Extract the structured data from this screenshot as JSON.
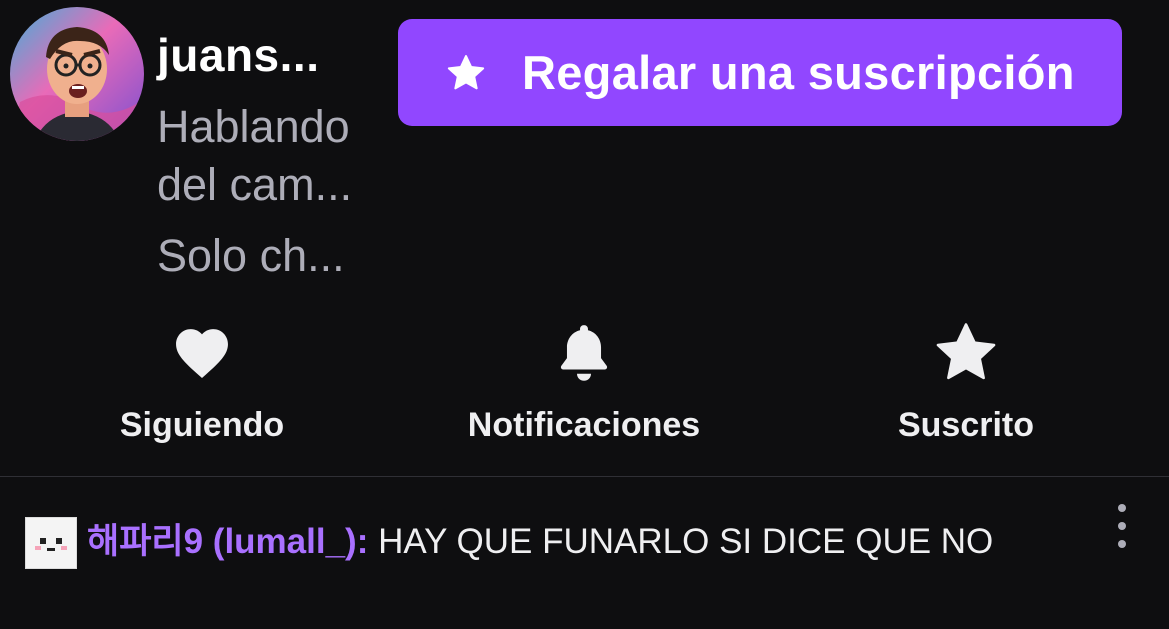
{
  "channel": {
    "name": "juans...",
    "title_line1": "Hablando",
    "title_line2": "del cam...",
    "category": "Solo ch..."
  },
  "gift_button": {
    "label": "Regalar una suscripción",
    "icon": "star-icon"
  },
  "actions": [
    {
      "label": "Siguiendo",
      "icon": "heart-icon"
    },
    {
      "label": "Notificaciones",
      "icon": "bell-icon"
    },
    {
      "label": "Suscrito",
      "icon": "star-icon"
    }
  ],
  "chat": {
    "username": "해파리9 (lumall_):",
    "message": " HAY QUE FUNARLO SI DICE QUE NO",
    "more_icon": "more-vertical-icon"
  },
  "colors": {
    "background": "#0e0e10",
    "accent": "#9147ff",
    "username": "#a970ff",
    "muted_text": "#adadb8"
  }
}
